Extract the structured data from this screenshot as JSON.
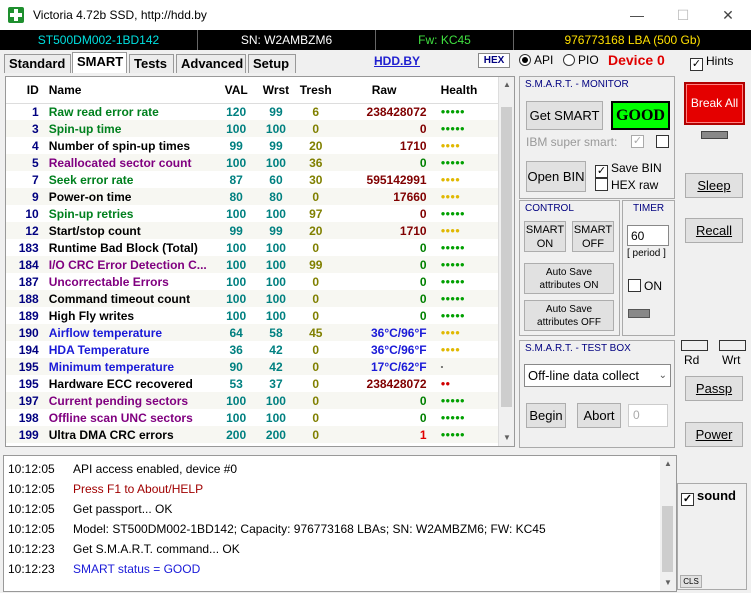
{
  "window": {
    "title": "Victoria 4.72b SSD, http://hdd.by",
    "minimize": "—",
    "maximize": "☐",
    "close": "✕"
  },
  "infobar": {
    "model": "ST500DM002-1BD142",
    "serial": "SN: W2AMBZM6",
    "firmware": "Fw: KC45",
    "capacity": "976773168 LBA (500 Gb)"
  },
  "tabs": [
    {
      "label": "Standard"
    },
    {
      "label": "SMART"
    },
    {
      "label": "Tests"
    },
    {
      "label": "Advanced"
    },
    {
      "label": "Setup"
    }
  ],
  "toolbar": {
    "hddby": "HDD.BY",
    "hex": "HEX",
    "api": "API",
    "pio": "PIO",
    "device": "Device 0",
    "hints": "Hints"
  },
  "grid": {
    "headers": [
      "ID",
      "Name",
      "VAL",
      "Wrst",
      "Tresh",
      "Raw",
      "Health"
    ],
    "rows": [
      {
        "id": "1",
        "name": "Raw read error rate",
        "val": "120",
        "wrst": "99",
        "tresh": "6",
        "raw": "238428072",
        "health": "●●●●●",
        "name_color": "#00801e",
        "raw_color": "#800000",
        "health_color": "#00a000"
      },
      {
        "id": "3",
        "name": "Spin-up time",
        "val": "100",
        "wrst": "100",
        "tresh": "0",
        "raw": "0",
        "health": "●●●●●",
        "name_color": "#00801e",
        "raw_color": "#800000",
        "health_color": "#00a000"
      },
      {
        "id": "4",
        "name": "Number of spin-up times",
        "val": "99",
        "wrst": "99",
        "tresh": "20",
        "raw": "1710",
        "health": "●●●●",
        "name_color": "#000000",
        "raw_color": "#800000",
        "health_color": "#e0b800"
      },
      {
        "id": "5",
        "name": "Reallocated sector count",
        "val": "100",
        "wrst": "100",
        "tresh": "36",
        "raw": "0",
        "health": "●●●●●",
        "name_color": "#800080",
        "raw_color": "#008000",
        "health_color": "#00a000"
      },
      {
        "id": "7",
        "name": "Seek error rate",
        "val": "87",
        "wrst": "60",
        "tresh": "30",
        "raw": "595142991",
        "health": "●●●●",
        "name_color": "#00801e",
        "raw_color": "#800000",
        "health_color": "#e0b800"
      },
      {
        "id": "9",
        "name": "Power-on time",
        "val": "80",
        "wrst": "80",
        "tresh": "0",
        "raw": "17660",
        "health": "●●●●",
        "name_color": "#000000",
        "raw_color": "#800000",
        "health_color": "#e0b800"
      },
      {
        "id": "10",
        "name": "Spin-up retries",
        "val": "100",
        "wrst": "100",
        "tresh": "97",
        "raw": "0",
        "health": "●●●●●",
        "name_color": "#00801e",
        "raw_color": "#800000",
        "health_color": "#00a000"
      },
      {
        "id": "12",
        "name": "Start/stop count",
        "val": "99",
        "wrst": "99",
        "tresh": "20",
        "raw": "1710",
        "health": "●●●●",
        "name_color": "#000000",
        "raw_color": "#800000",
        "health_color": "#e0b800"
      },
      {
        "id": "183",
        "name": "Runtime Bad Block (Total)",
        "val": "100",
        "wrst": "100",
        "tresh": "0",
        "raw": "0",
        "health": "●●●●●",
        "name_color": "#000000",
        "raw_color": "#008000",
        "health_color": "#00a000"
      },
      {
        "id": "184",
        "name": "I/O CRC Error Detection C...",
        "val": "100",
        "wrst": "100",
        "tresh": "99",
        "raw": "0",
        "health": "●●●●●",
        "name_color": "#800080",
        "raw_color": "#008000",
        "health_color": "#00a000"
      },
      {
        "id": "187",
        "name": "Uncorrectable Errors",
        "val": "100",
        "wrst": "100",
        "tresh": "0",
        "raw": "0",
        "health": "●●●●●",
        "name_color": "#800080",
        "raw_color": "#008000",
        "health_color": "#00a000"
      },
      {
        "id": "188",
        "name": "Command timeout count",
        "val": "100",
        "wrst": "100",
        "tresh": "0",
        "raw": "0",
        "health": "●●●●●",
        "name_color": "#000000",
        "raw_color": "#008000",
        "health_color": "#00a000"
      },
      {
        "id": "189",
        "name": "High Fly writes",
        "val": "100",
        "wrst": "100",
        "tresh": "0",
        "raw": "0",
        "health": "●●●●●",
        "name_color": "#000000",
        "raw_color": "#008000",
        "health_color": "#00a000"
      },
      {
        "id": "190",
        "name": "Airflow temperature",
        "val": "64",
        "wrst": "58",
        "tresh": "45",
        "raw": "36°C/96°F",
        "health": "●●●●",
        "name_color": "#1a1ad8",
        "raw_color": "#1a1ad8",
        "health_color": "#e0b800"
      },
      {
        "id": "194",
        "name": "HDA Temperature",
        "val": "36",
        "wrst": "42",
        "tresh": "0",
        "raw": "36°C/96°F",
        "health": "●●●●",
        "name_color": "#1a1ad8",
        "raw_color": "#1a1ad8",
        "health_color": "#e0b800"
      },
      {
        "id": "195",
        "name": "Minimum temperature",
        "val": "90",
        "wrst": "42",
        "tresh": "0",
        "raw": "17°C/62°F",
        "health": "-",
        "name_color": "#1a1ad8",
        "raw_color": "#1a1ad8",
        "health_color": "#000000"
      },
      {
        "id": "195",
        "name": "Hardware ECC recovered",
        "val": "53",
        "wrst": "37",
        "tresh": "0",
        "raw": "238428072",
        "health": "●●",
        "name_color": "#000000",
        "raw_color": "#800000",
        "health_color": "#d00000"
      },
      {
        "id": "197",
        "name": "Current pending sectors",
        "val": "100",
        "wrst": "100",
        "tresh": "0",
        "raw": "0",
        "health": "●●●●●",
        "name_color": "#800080",
        "raw_color": "#008000",
        "health_color": "#00a000"
      },
      {
        "id": "198",
        "name": "Offline scan UNC sectors",
        "val": "100",
        "wrst": "100",
        "tresh": "0",
        "raw": "0",
        "health": "●●●●●",
        "name_color": "#800080",
        "raw_color": "#008000",
        "health_color": "#00a000"
      },
      {
        "id": "199",
        "name": "Ultra DMA CRC errors",
        "val": "200",
        "wrst": "200",
        "tresh": "0",
        "raw": "1",
        "health": "●●●●●",
        "name_color": "#000000",
        "raw_color": "#e00000",
        "health_color": "#00a000"
      }
    ]
  },
  "monitor": {
    "title": "S.M.A.R.T. - MONITOR",
    "get_smart": "Get SMART",
    "status": "GOOD",
    "ibm": "IBM super smart:",
    "open_bin": "Open BIN",
    "save_bin": "Save BIN",
    "hex_raw": "HEX raw"
  },
  "control": {
    "title": "CONTROL",
    "smart_on": "SMART ON",
    "smart_off": "SMART OFF",
    "autosave_on": "Auto Save attributes ON",
    "autosave_off": "Auto Save attributes OFF"
  },
  "timer": {
    "title": "TIMER",
    "value": "60",
    "period": "[ period ]",
    "on": "ON"
  },
  "testbox": {
    "title": "S.M.A.R.T. - TEST BOX",
    "select": "Off-line data collect",
    "begin": "Begin",
    "abort": "Abort",
    "value": "0"
  },
  "right": {
    "break_all": "Break All",
    "sleep": "Sleep",
    "recall": "Recall",
    "rd": "Rd",
    "wrt": "Wrt",
    "passp": "Passp",
    "power": "Power",
    "sound": "sound",
    "cls": "CLS"
  },
  "log": [
    {
      "time": "10:12:05",
      "text": "API access enabled, device #0",
      "color": "#000000"
    },
    {
      "time": "10:12:05",
      "text": "Press F1 to About/HELP",
      "color": "#a00000"
    },
    {
      "time": "10:12:05",
      "text": "Get passport... OK",
      "color": "#000000"
    },
    {
      "time": "10:12:05",
      "text": "Model: ST500DM002-1BD142; Capacity: 976773168 LBAs; SN: W2AMBZM6; FW: KC45",
      "color": "#000000"
    },
    {
      "time": "10:12:23",
      "text": "Get S.M.A.R.T. command... OK",
      "color": "#000000"
    },
    {
      "time": "10:12:23",
      "text": "SMART status = GOOD",
      "color": "#1a1ad8"
    }
  ]
}
